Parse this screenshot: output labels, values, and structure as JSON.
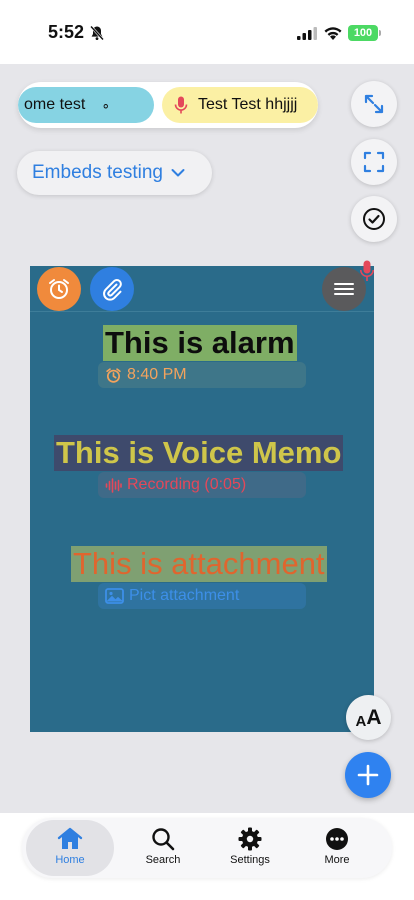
{
  "status_bar": {
    "time": "5:52",
    "battery": "100"
  },
  "tabs_strip": {
    "tabs": [
      {
        "label": "ome test",
        "trailing": "∘"
      },
      {
        "label": "Test  Test hhjjjj"
      }
    ]
  },
  "toolbar_right": {
    "icons": [
      "expand-icon",
      "fullscreen-icon",
      "checkmark-icon"
    ]
  },
  "notebook_selector": {
    "label": "Embeds testing"
  },
  "editor": {
    "blocks": [
      {
        "heading": "This is alarm",
        "chip_text": "8:40 PM"
      },
      {
        "heading": "This is Voice Memo",
        "chip_text": "Recording (0:05)"
      },
      {
        "heading": "This is attachment",
        "chip_text": "Pict attachment"
      }
    ]
  },
  "font_button": {
    "small": "A",
    "big": "A"
  },
  "tab_bar": {
    "items": [
      {
        "label": "Home",
        "icon": "home-icon",
        "active": true
      },
      {
        "label": "Search",
        "icon": "search-icon"
      },
      {
        "label": "Settings",
        "icon": "gear-icon"
      },
      {
        "label": "More",
        "icon": "more-icon"
      }
    ]
  },
  "colors": {
    "accent": "#2f7fe0",
    "editor_bg": "#2a6b8a",
    "alarm_orange": "#f08a3c",
    "record_red": "#e4485a"
  }
}
